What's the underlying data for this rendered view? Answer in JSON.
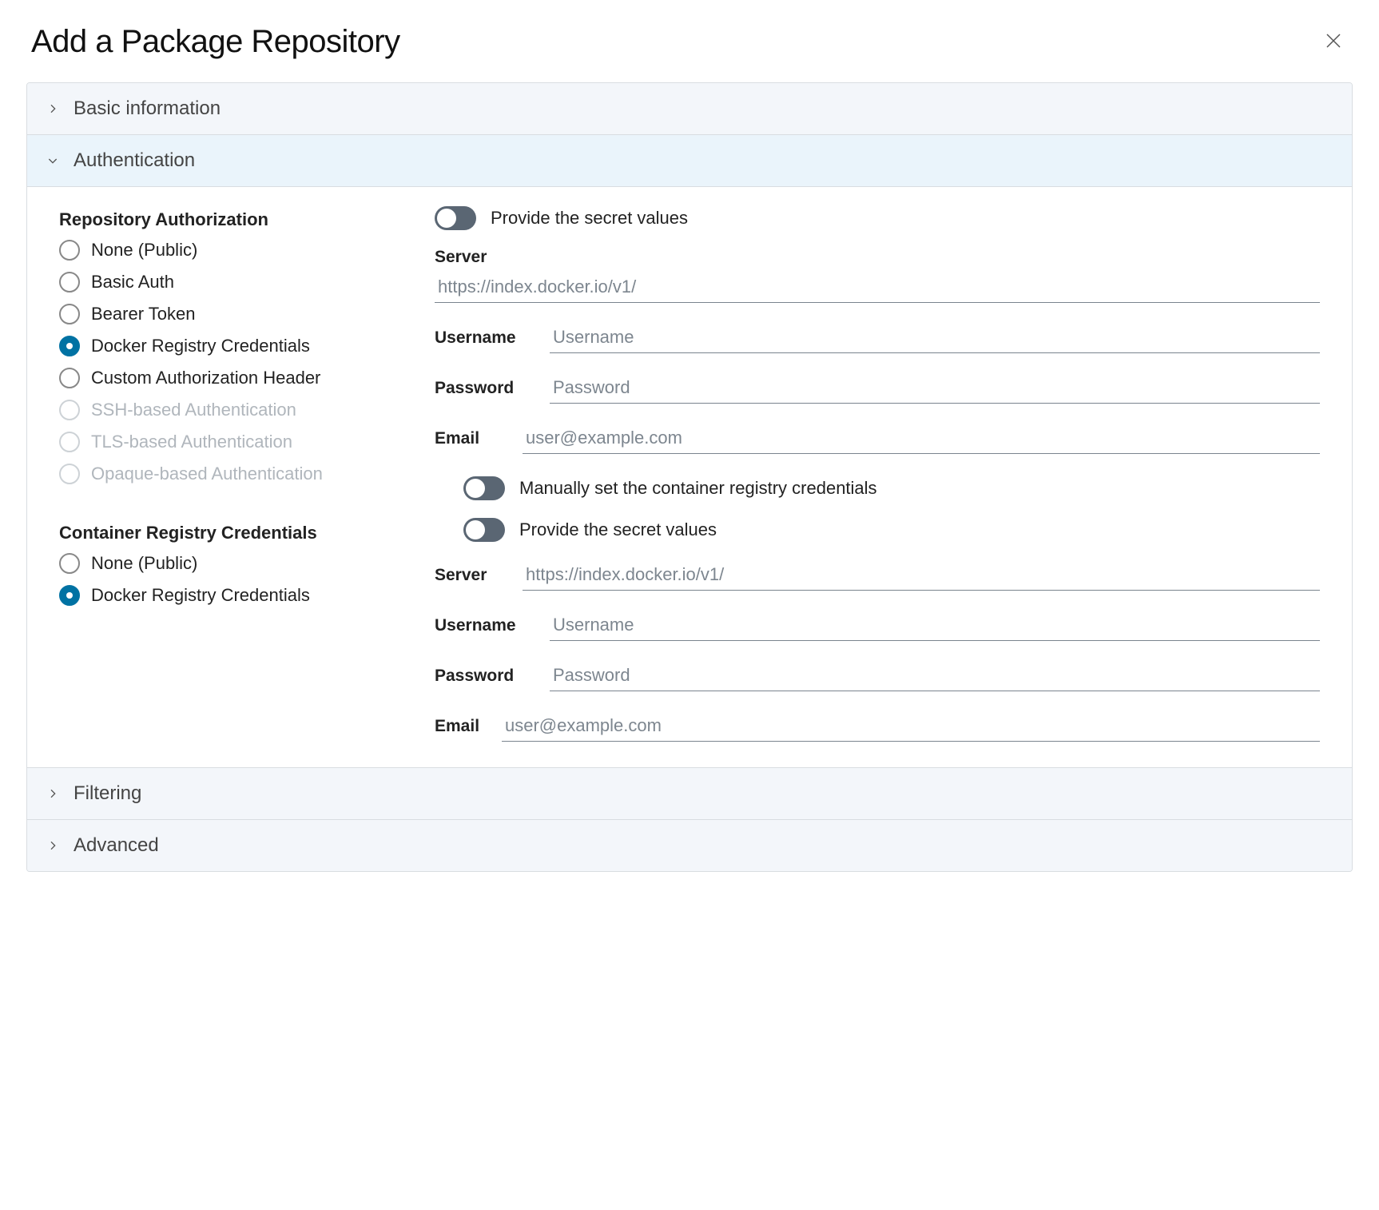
{
  "title": "Add a Package Repository",
  "sections": {
    "basic": "Basic information",
    "auth": "Authentication",
    "filtering": "Filtering",
    "advanced": "Advanced"
  },
  "repoAuth": {
    "heading": "Repository Authorization",
    "options": {
      "none": "None (Public)",
      "basic": "Basic Auth",
      "bearer": "Bearer Token",
      "docker": "Docker Registry Credentials",
      "custom": "Custom Authorization Header",
      "ssh": "SSH-based Authentication",
      "tls": "TLS-based Authentication",
      "opaque": "Opaque-based Authentication"
    }
  },
  "containerCreds": {
    "heading": "Container Registry Credentials",
    "options": {
      "none": "None (Public)",
      "docker": "Docker Registry Credentials"
    }
  },
  "toggles": {
    "provideSecret1": "Provide the secret values",
    "manualSet": "Manually set the container registry credentials",
    "provideSecret2": "Provide the secret values"
  },
  "fields": {
    "serverLabel": "Server",
    "serverPlaceholder": "https://index.docker.io/v1/",
    "usernameLabel": "Username",
    "usernamePlaceholder": "Username",
    "passwordLabel": "Password",
    "passwordPlaceholder": "Password",
    "emailLabel": "Email",
    "emailPlaceholder": "user@example.com"
  }
}
